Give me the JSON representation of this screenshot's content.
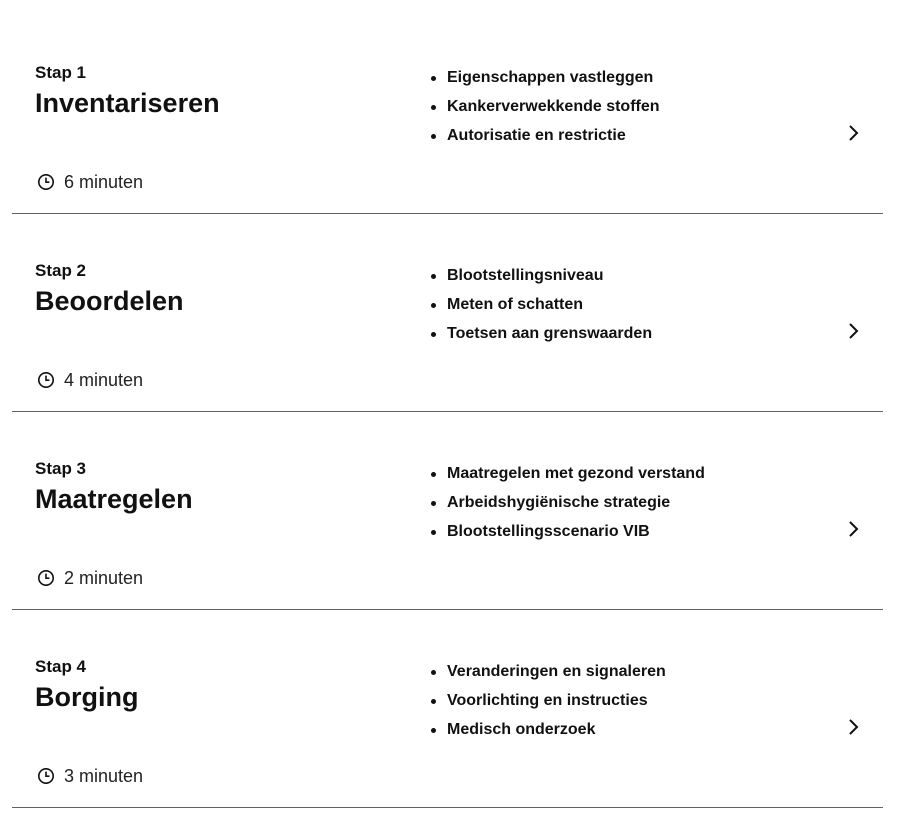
{
  "steps": [
    {
      "label": "Stap 1",
      "title": "Inventariseren",
      "duration": "6 minuten",
      "topics": [
        "Eigenschappen vastleggen",
        "Kankerverwekkende stoffen",
        "Autorisatie en restrictie"
      ]
    },
    {
      "label": "Stap 2",
      "title": "Beoordelen",
      "duration": "4 minuten",
      "topics": [
        "Blootstellingsniveau",
        "Meten of schatten",
        "Toetsen aan grenswaarden"
      ]
    },
    {
      "label": "Stap 3",
      "title": "Maatregelen",
      "duration": "2 minuten",
      "topics": [
        "Maatregelen met gezond verstand",
        "Arbeidshygiënische strategie",
        "Blootstellingsscenario VIB"
      ]
    },
    {
      "label": "Stap 4",
      "title": "Borging",
      "duration": "3 minuten",
      "topics": [
        "Veranderingen en signaleren",
        "Voorlichting en instructies",
        "Medisch onderzoek"
      ]
    }
  ],
  "colors": {
    "divider": "#a8329a",
    "text": "#111111"
  },
  "icons": {
    "duration": "clock-icon",
    "navigate": "chevron-right-icon"
  }
}
